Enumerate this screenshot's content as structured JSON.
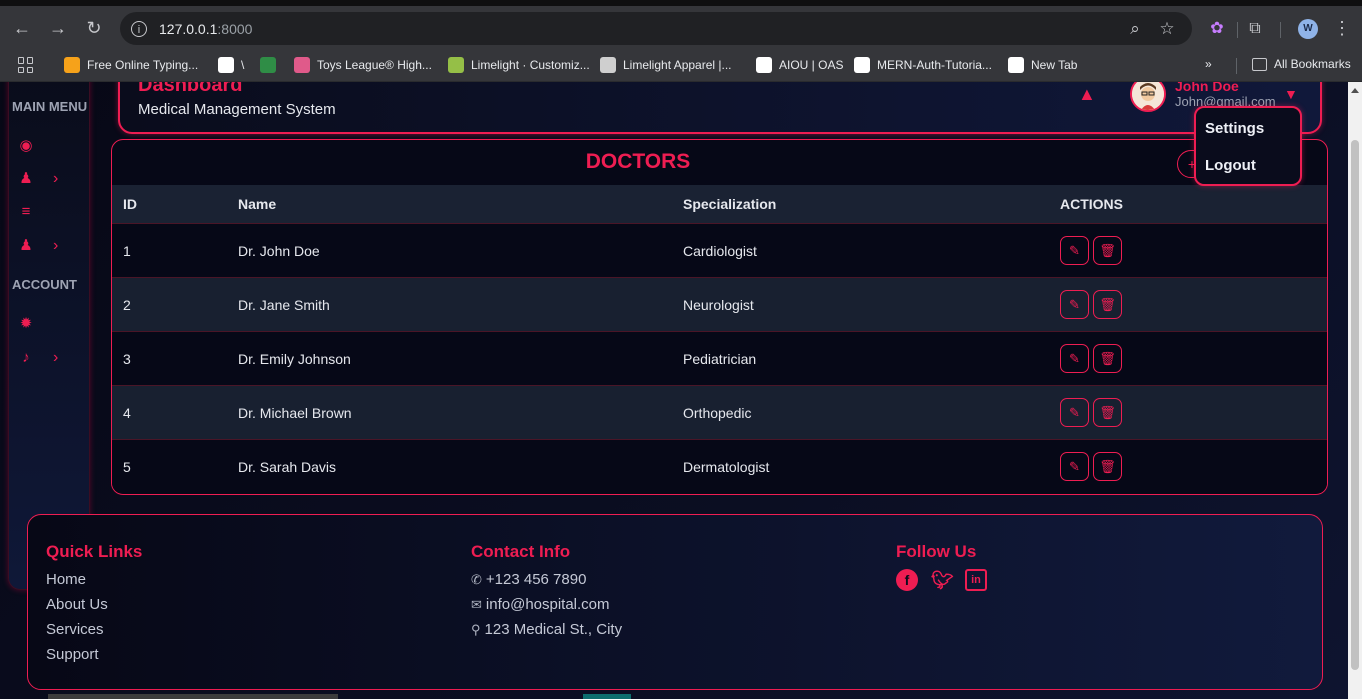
{
  "browser": {
    "url_host": "127.0.0.1",
    "url_port": ":8000",
    "profile_initial": "W",
    "bookmarks": [
      {
        "label": "Free Online Typing...",
        "icon": "typing-icon",
        "color": "#f6a21a"
      },
      {
        "label": "\\",
        "icon": "github-icon",
        "color": "#ffffff"
      },
      {
        "label": "",
        "icon": "geeks-icon",
        "color": "#2f8d46"
      },
      {
        "label": "Toys League® High...",
        "icon": "toys-icon",
        "color": "#e05a8a"
      },
      {
        "label": "Limelight · Customiz...",
        "icon": "shopify-icon",
        "color": "#95bf47"
      },
      {
        "label": "Limelight Apparel |...",
        "icon": "limelight-icon",
        "color": "#cfcfcf"
      },
      {
        "label": "AIOU | OAS",
        "icon": "globe-icon",
        "color": "#ffffff"
      },
      {
        "label": "MERN-Auth-Tutoria...",
        "icon": "github-icon",
        "color": "#ffffff"
      },
      {
        "label": "New Tab",
        "icon": "globe-icon",
        "color": "#ffffff"
      }
    ],
    "all_bookmarks": "All Bookmarks"
  },
  "sidebar": {
    "main_menu": "MAIN MENU",
    "account": "ACCOUNT"
  },
  "header": {
    "title": "Dashboard",
    "subtitle": "Medical Management System",
    "user_name": "John Doe",
    "user_email": "John@gmail.com"
  },
  "dropdown": {
    "settings": "Settings",
    "logout": "Logout"
  },
  "doctors": {
    "title": "DOCTORS",
    "columns": [
      "ID",
      "Name",
      "Specialization",
      "ACTIONS"
    ],
    "rows": [
      {
        "id": "1",
        "name": "Dr. John Doe",
        "specialization": "Cardiologist"
      },
      {
        "id": "2",
        "name": "Dr. Jane Smith",
        "specialization": "Neurologist"
      },
      {
        "id": "3",
        "name": "Dr. Emily Johnson",
        "specialization": "Pediatrician"
      },
      {
        "id": "4",
        "name": "Dr. Michael Brown",
        "specialization": "Orthopedic"
      },
      {
        "id": "5",
        "name": "Dr. Sarah Davis",
        "specialization": "Dermatologist"
      }
    ]
  },
  "footer": {
    "quick_links_title": "Quick Links",
    "quick_links": [
      "Home",
      "About Us",
      "Services",
      "Support"
    ],
    "contact_title": "Contact Info",
    "phone": "+123 456 7890",
    "email": "info@hospital.com",
    "address": "123 Medical St., City",
    "follow_title": "Follow Us",
    "social": [
      "facebook-icon",
      "twitter-icon",
      "linkedin-icon"
    ]
  },
  "colors": {
    "accent": "#ee1d52",
    "background": "#070816",
    "row_alt": "#182030"
  }
}
